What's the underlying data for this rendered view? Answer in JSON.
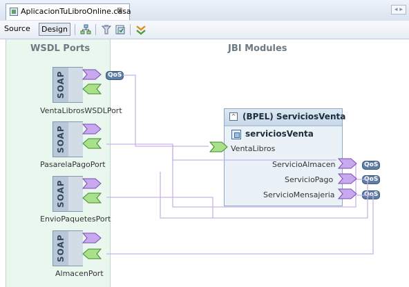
{
  "tab": {
    "title": "AplicacionTuLibroOnline.casa",
    "close_symbol": "⊠",
    "nav_symbol": "◂ ▸"
  },
  "toolbar": {
    "source_label": "Source",
    "design_label": "Design",
    "icons": [
      "layout-icon",
      "build-icon",
      "deploy-icon",
      "validate-icon"
    ]
  },
  "columns": {
    "left_title": "WSDL Ports",
    "right_title": "JBI Modules"
  },
  "wsdl_ports": [
    {
      "binding": "SOAP",
      "name": "VentaLibrosWSDLPort",
      "qos": "QoS"
    },
    {
      "binding": "SOAP",
      "name": "PasarelaPagoPort",
      "qos": ""
    },
    {
      "binding": "SOAP",
      "name": "EnvioPaquetesPort",
      "qos": ""
    },
    {
      "binding": "SOAP",
      "name": "AlmacenPort",
      "qos": ""
    }
  ],
  "bpel_module": {
    "title": "(BPEL) ServiciosVenta",
    "collapse_symbol": "^",
    "service_unit": "serviciosVenta",
    "provides": [
      {
        "name": "VentaLibros"
      }
    ],
    "consumes": [
      {
        "name": "ServicioAlmacen",
        "qos": "QoS"
      },
      {
        "name": "ServicioPago",
        "qos": "QoS"
      },
      {
        "name": "ServicioMensajeria",
        "qos": "QoS"
      }
    ]
  },
  "colors": {
    "provide_arrow": "#b48be0",
    "consume_arrow": "#7ccf5e",
    "connector": "#c7b3e6",
    "left_panel": "#eaf7ee"
  }
}
